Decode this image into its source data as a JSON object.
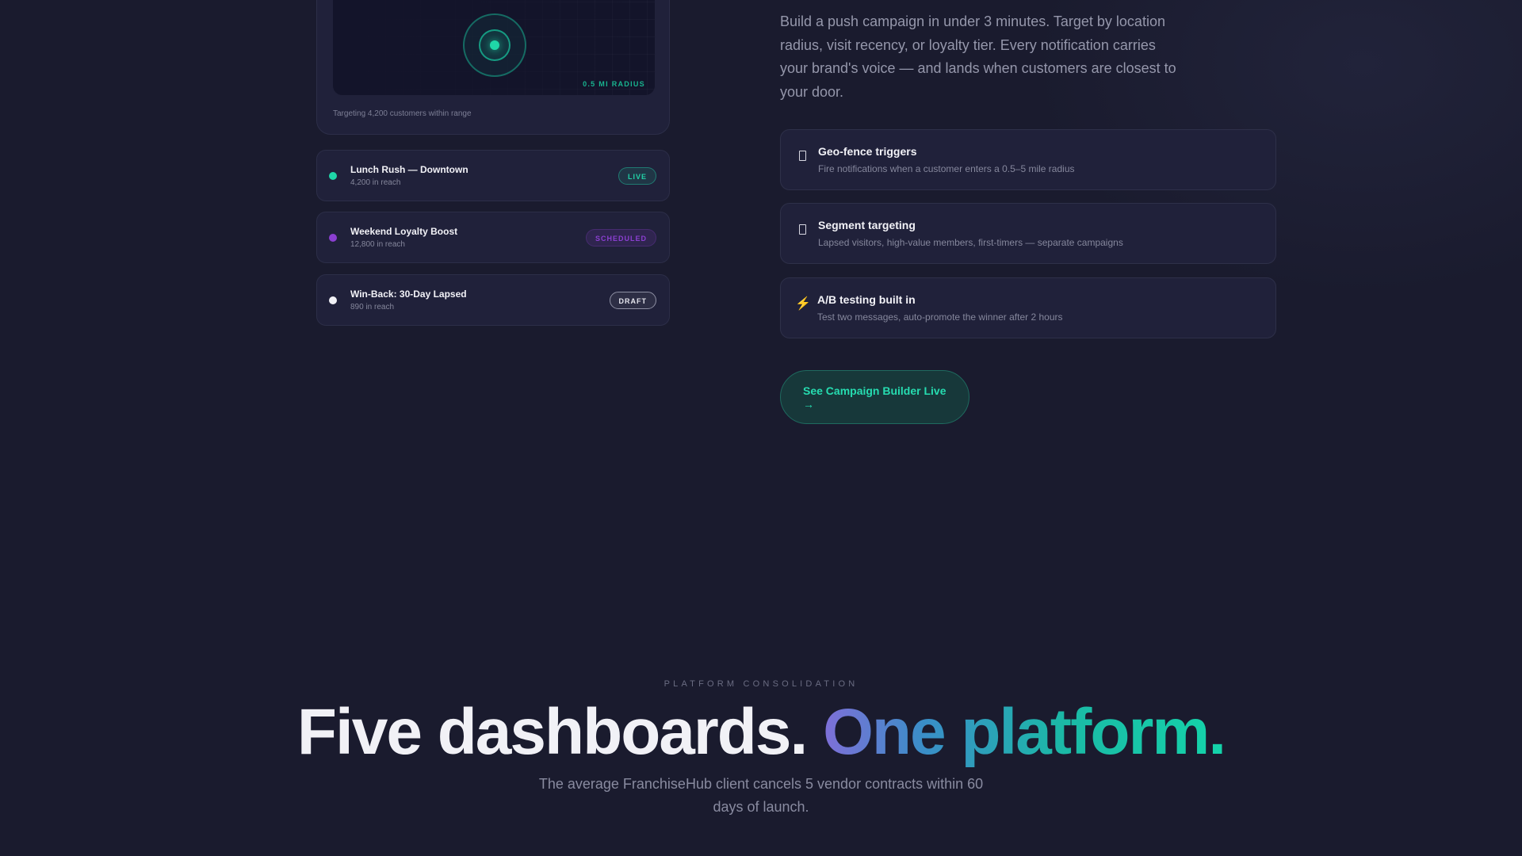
{
  "map_card": {
    "radius_label": "0.5 MI RADIUS",
    "targeting_text": "Targeting 4,200 customers within range"
  },
  "campaigns": [
    {
      "title": "Lunch Rush — Downtown",
      "reach": "4,200 in reach",
      "status": "LIVE",
      "dot_color": "#1fd6a8"
    },
    {
      "title": "Weekend Loyalty Boost",
      "reach": "12,800 in reach",
      "status": "SCHEDULED",
      "dot_color": "#8b3fd1"
    },
    {
      "title": "Win-Back: 30-Day Lapsed",
      "reach": "890 in reach",
      "status": "DRAFT",
      "dot_color": "#f1f1f6"
    }
  ],
  "intro": {
    "text": "Build a push campaign in under 3 minutes. Target by location radius, visit recency, or loyalty tier. Every notification carries your brand's voice — and lands when customers are closest to your door."
  },
  "features": [
    {
      "icon": "location-pin-icon",
      "title": "Geo-fence triggers",
      "desc": "Fire notifications when a customer enters a 0.5–5 mile radius"
    },
    {
      "icon": "segment-icon",
      "title": "Segment targeting",
      "desc": "Lapsed visitors, high-value members, first-timers — separate campaigns"
    },
    {
      "icon": "lightning-icon",
      "glyph": "⚡",
      "title": "A/B testing built in",
      "desc": "Test two messages, auto-promote the winner after 2 hours"
    }
  ],
  "cta": {
    "label": "See Campaign Builder Live",
    "arrow": "→"
  },
  "consolidation": {
    "eyebrow": "PLATFORM CONSOLIDATION",
    "headline_white": "Five dashboards.",
    "headline_gradient": "One platform.",
    "subhead": "The average FranchiseHub client cancels 5 vendor contracts within 60 days of launch."
  },
  "colors": {
    "background": "#1a1b2e",
    "card": "#20213a",
    "accent_teal": "#1fd6a8",
    "accent_purple": "#8b3fd1"
  }
}
